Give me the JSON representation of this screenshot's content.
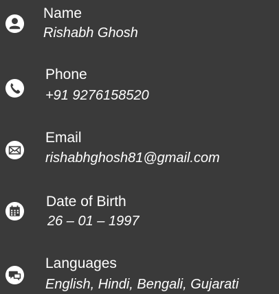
{
  "contact": {
    "items": [
      {
        "icon": "user-icon",
        "label": "Name",
        "value": "Rishabh Ghosh"
      },
      {
        "icon": "phone-icon",
        "label": "Phone",
        "value": "+91 9276158520"
      },
      {
        "icon": "envelope-icon",
        "label": "Email",
        "value": "rishabhghosh81@gmail.com"
      },
      {
        "icon": "calendar-icon",
        "label": "Date of Birth",
        "value": "26 – 01 – 1997"
      },
      {
        "icon": "chat-icon",
        "label": "Languages",
        "value": "English, Hindi, Bengali, Gujarati"
      }
    ]
  },
  "colors": {
    "background": "#3a3a3a",
    "text": "#ffffff",
    "icon": "#ffffff"
  }
}
